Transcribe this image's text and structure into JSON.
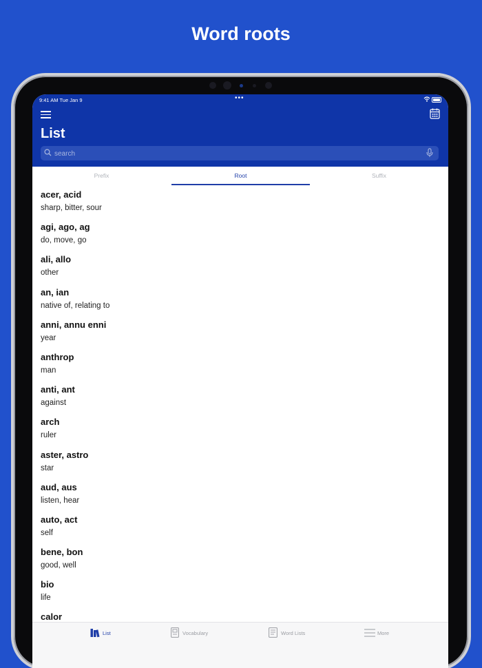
{
  "headline": "Word roots",
  "status": {
    "time": "9:41 AM   Tue Jan 9",
    "dots": "•••"
  },
  "header": {
    "title": "List",
    "search_placeholder": "search"
  },
  "tabs": [
    {
      "label": "Prefix",
      "active": false
    },
    {
      "label": "Root",
      "active": true
    },
    {
      "label": "Suffix",
      "active": false
    }
  ],
  "items": [
    {
      "term": "acer, acid",
      "meaning": "sharp, bitter, sour"
    },
    {
      "term": "agi, ago, ag",
      "meaning": "do, move, go"
    },
    {
      "term": "ali, allo",
      "meaning": "other"
    },
    {
      "term": "an, ian",
      "meaning": "native of, relating to"
    },
    {
      "term": "anni, annu enni",
      "meaning": "year"
    },
    {
      "term": "anthrop",
      "meaning": "man"
    },
    {
      "term": "anti, ant",
      "meaning": "against"
    },
    {
      "term": "arch",
      "meaning": "ruler"
    },
    {
      "term": "aster, astro",
      "meaning": "star"
    },
    {
      "term": "aud, aus",
      "meaning": "listen, hear"
    },
    {
      "term": "auto, act",
      "meaning": "self"
    },
    {
      "term": "bene, bon",
      "meaning": "good, well"
    },
    {
      "term": "bio",
      "meaning": "life"
    },
    {
      "term": "calor",
      "meaning": ""
    }
  ],
  "tabbar": [
    {
      "label": "List",
      "icon": "books-icon",
      "active": true
    },
    {
      "label": "Vocabulary",
      "icon": "vocabulary-book-icon",
      "active": false
    },
    {
      "label": "Word Lists",
      "icon": "document-icon",
      "active": false
    },
    {
      "label": "More",
      "icon": "menu-lines-icon",
      "active": false
    }
  ],
  "colors": {
    "background": "#2151cc",
    "appbar": "#0f35a8",
    "accent": "#1f3ea8"
  }
}
